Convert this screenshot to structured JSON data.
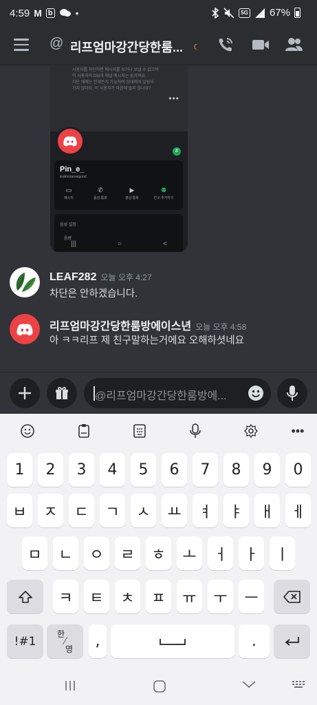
{
  "status": {
    "time": "4:59",
    "left_icons": [
      "M",
      "b"
    ],
    "battery": "67%",
    "network": "5G"
  },
  "header": {
    "at": "@",
    "title": "리프엄마강간당한룸...",
    "moon": "☾"
  },
  "embed": {
    "faint_lines": [
      "사용자를 차단하면 메시지를 보거나 보낼 수 없으며",
      "이 사용자의 DM과 채널 메시지는 숨겨져요.",
      "차단 해제는 언제든지 가능하며 상대에게 알림이",
      "가지 않아요. 이 사용자가 마음에 들지 않나요?"
    ],
    "dots": "•••",
    "badge": "#",
    "profile_name": "Pin_e_",
    "profile_sub": "leafmotarealgood",
    "actions": [
      "메시지",
      "음성 통화",
      "영상 통화",
      "친구 추가하기"
    ],
    "section1": "음성 설정",
    "section2": "음량",
    "nav": [
      "|||",
      "○",
      "<"
    ]
  },
  "messages": [
    {
      "author": "LEAF282",
      "time": "오늘 오후 4:27",
      "text": "차단은 안하겠습니다."
    },
    {
      "author": "리프엄마강간당한룸방에이스년",
      "time": "오늘 오후 4:58",
      "text": "아 ㅋㅋ리프 제 친구말하는거에요 오해하셧네요"
    }
  ],
  "composer": {
    "placeholder": "@리프엄마강간당한룸방에..."
  },
  "keyboard": {
    "numbers": [
      "1",
      "2",
      "3",
      "4",
      "5",
      "6",
      "7",
      "8",
      "9",
      "0"
    ],
    "row1": [
      "ㅂ",
      "ㅈ",
      "ㄷ",
      "ㄱ",
      "ㅅ",
      "ㅛ",
      "ㅕ",
      "ㅑ",
      "ㅐ",
      "ㅔ"
    ],
    "row2": [
      "ㅁ",
      "ㄴ",
      "ㅇ",
      "ㄹ",
      "ㅎ",
      "ㅗ",
      "ㅓ",
      "ㅏ",
      "ㅣ"
    ],
    "row3": [
      "ㅋ",
      "ㅌ",
      "ㅊ",
      "ㅍ",
      "ㅠ",
      "ㅜ",
      "ㅡ"
    ],
    "symbols": "!#1",
    "lang_top": "한",
    "lang_bottom": "영",
    "comma": ",",
    "period": "."
  },
  "colors": {
    "discord_red": "#ed4245",
    "online": "#23a559",
    "leaf_green": "#2e6b2f"
  }
}
